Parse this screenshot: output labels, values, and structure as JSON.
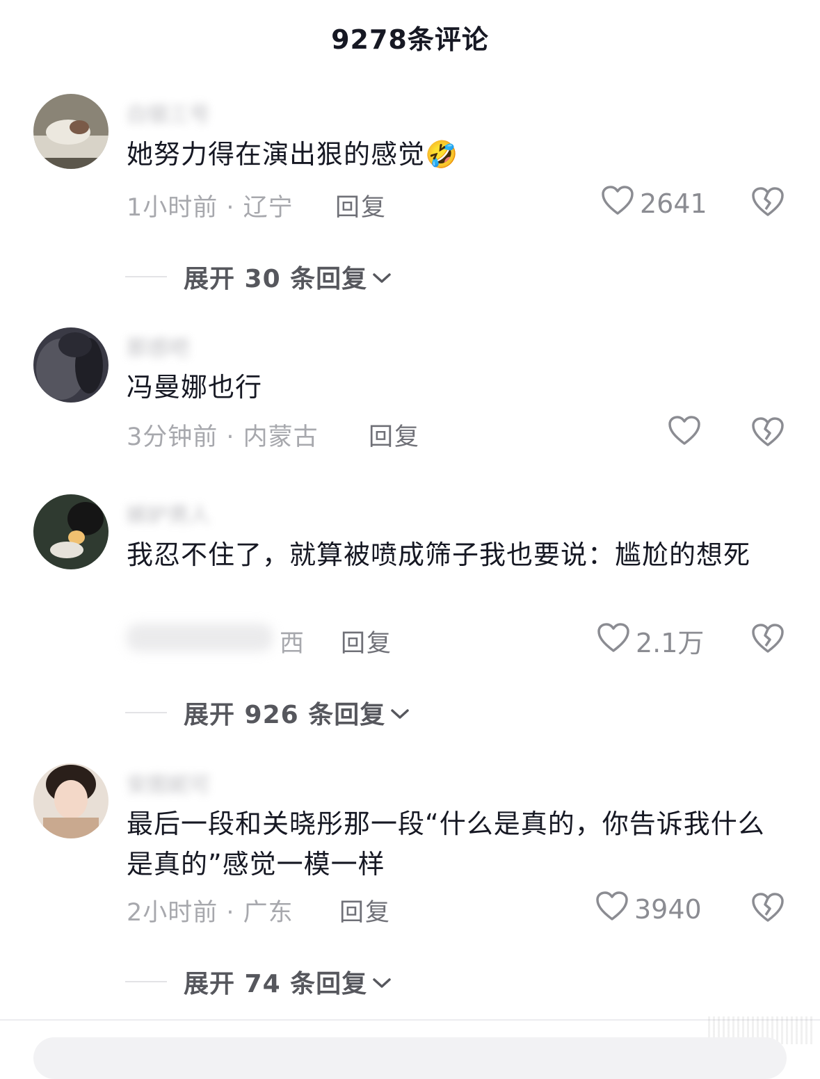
{
  "header": {
    "title": "9278条评论"
  },
  "comments": [
    {
      "username": "白银三号",
      "text": "她努力得在演出狠的感觉🤣",
      "meta": "1小时前 · 辽宁",
      "reply_label": "回复",
      "likes": "2641",
      "expand_label": "展开 30 条回复"
    },
    {
      "username": "那感吧",
      "text": "冯曼娜也行",
      "meta": "3分钟前 · 内蒙古",
      "reply_label": "回复",
      "likes": "",
      "expand_label": ""
    },
    {
      "username": "嫉妒男人",
      "text": "我忍不住了，就算被喷成筛子我也要说：尴尬的想死",
      "meta": "西",
      "reply_label": "回复",
      "likes": "2.1万",
      "expand_label": "展开 926 条回复"
    },
    {
      "username": "安图妮可",
      "text": "最后一段和关晓彤那一段“什么是真的，你告诉我什么是真的”感觉一模一样",
      "meta": "2小时前 · 广东",
      "reply_label": "回复",
      "likes": "3940",
      "expand_label": "展开 74 条回复"
    }
  ],
  "colors": {
    "primary_text": "#161823",
    "secondary_text": "#a7a8ad",
    "icon": "#8b8c92"
  },
  "icons": [
    "heart-outline-icon",
    "broken-heart-icon",
    "chevron-down-icon"
  ]
}
